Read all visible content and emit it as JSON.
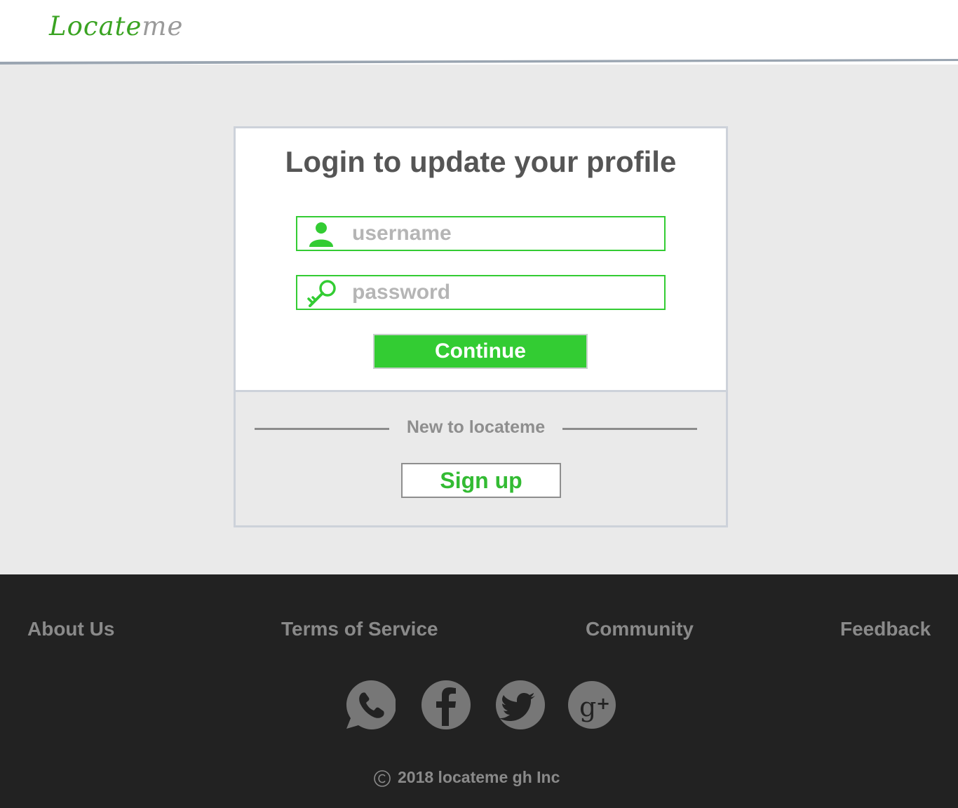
{
  "header": {
    "logo_part1": "Locate",
    "logo_part2": "me"
  },
  "login": {
    "title": "Login to update your profile",
    "username_placeholder": "username",
    "password_placeholder": "password",
    "continue_label": "Continue",
    "new_to_text": "New to locateme",
    "signup_label": "Sign up"
  },
  "footer": {
    "links": [
      "About Us",
      "Terms of Service",
      "Community",
      "Feedback"
    ],
    "social_icons": [
      "whatsapp-icon",
      "facebook-icon",
      "twitter-icon",
      "google-plus-icon"
    ],
    "copyright": "2018 locateme gh Inc"
  },
  "colors": {
    "accent_green": "#33cc33",
    "logo_green": "#3aa322",
    "footer_bg": "#222222",
    "page_bg": "#eaeaea"
  }
}
